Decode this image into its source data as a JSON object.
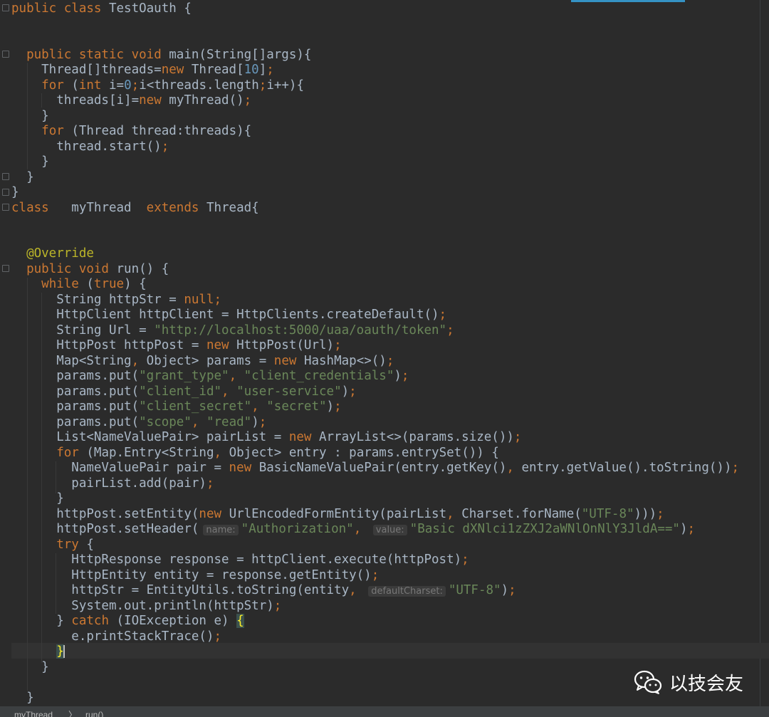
{
  "editor": {
    "lines": [
      [
        [
          "kw",
          "public class "
        ],
        [
          "plain",
          "TestOauth {"
        ]
      ],
      [],
      [],
      [
        [
          "plain",
          "  "
        ],
        [
          "kw",
          "public static void "
        ],
        [
          "plain",
          "main(String[]args){"
        ]
      ],
      [
        [
          "plain",
          "    Thread[]threads="
        ],
        [
          "kw",
          "new "
        ],
        [
          "plain",
          "Thread["
        ],
        [
          "num",
          "10"
        ],
        [
          "plain",
          "]"
        ],
        [
          "kw",
          ";"
        ]
      ],
      [
        [
          "plain",
          "    "
        ],
        [
          "kw",
          "for "
        ],
        [
          "plain",
          "("
        ],
        [
          "kw",
          "int "
        ],
        [
          "plain",
          "i="
        ],
        [
          "num",
          "0"
        ],
        [
          "kw",
          ";"
        ],
        [
          "plain",
          "i<threads.length"
        ],
        [
          "kw",
          ";"
        ],
        [
          "plain",
          "i++){"
        ]
      ],
      [
        [
          "plain",
          "      threads[i]="
        ],
        [
          "kw",
          "new "
        ],
        [
          "plain",
          "myThread()"
        ],
        [
          "kw",
          ";"
        ]
      ],
      [
        [
          "plain",
          "    }"
        ]
      ],
      [
        [
          "plain",
          "    "
        ],
        [
          "kw",
          "for "
        ],
        [
          "plain",
          "(Thread thread:threads){"
        ]
      ],
      [
        [
          "plain",
          "      thread.start()"
        ],
        [
          "kw",
          ";"
        ]
      ],
      [
        [
          "plain",
          "    }"
        ]
      ],
      [
        [
          "plain",
          "  }"
        ]
      ],
      [
        [
          "plain",
          "}"
        ]
      ],
      [
        [
          "kw",
          "class   "
        ],
        [
          "plain",
          "myThread  "
        ],
        [
          "kw",
          "extends "
        ],
        [
          "plain",
          "Thread{"
        ]
      ],
      [],
      [],
      [
        [
          "ann",
          "  @Override"
        ]
      ],
      [
        [
          "plain",
          "  "
        ],
        [
          "kw",
          "public void "
        ],
        [
          "plain",
          "run() {"
        ]
      ],
      [
        [
          "plain",
          "    "
        ],
        [
          "kw",
          "while "
        ],
        [
          "plain",
          "("
        ],
        [
          "kw",
          "true"
        ],
        [
          "plain",
          ") {"
        ]
      ],
      [
        [
          "plain",
          "      String httpStr = "
        ],
        [
          "kw",
          "null;"
        ]
      ],
      [
        [
          "plain",
          "      HttpClient httpClient = HttpClients.createDefault()"
        ],
        [
          "kw",
          ";"
        ]
      ],
      [
        [
          "plain",
          "      String Url = "
        ],
        [
          "str",
          "\"http://localhost:5000/uaa/oauth/token\""
        ],
        [
          "kw",
          ";"
        ]
      ],
      [
        [
          "plain",
          "      HttpPost httpPost = "
        ],
        [
          "kw",
          "new "
        ],
        [
          "plain",
          "HttpPost(Url)"
        ],
        [
          "kw",
          ";"
        ]
      ],
      [
        [
          "plain",
          "      Map<String"
        ],
        [
          "kw",
          ", "
        ],
        [
          "plain",
          "Object> params = "
        ],
        [
          "kw",
          "new "
        ],
        [
          "plain",
          "HashMap<>()"
        ],
        [
          "kw",
          ";"
        ]
      ],
      [
        [
          "plain",
          "      params.put("
        ],
        [
          "str",
          "\"grant_type\""
        ],
        [
          "kw",
          ", "
        ],
        [
          "str",
          "\"client_credentials\""
        ],
        [
          "plain",
          ")"
        ],
        [
          "kw",
          ";"
        ]
      ],
      [
        [
          "plain",
          "      params.put("
        ],
        [
          "str",
          "\"client_id\""
        ],
        [
          "kw",
          ", "
        ],
        [
          "str",
          "\"user-service\""
        ],
        [
          "plain",
          ")"
        ],
        [
          "kw",
          ";"
        ]
      ],
      [
        [
          "plain",
          "      params.put("
        ],
        [
          "str",
          "\"client_secret\""
        ],
        [
          "kw",
          ", "
        ],
        [
          "str",
          "\"secret\""
        ],
        [
          "plain",
          ")"
        ],
        [
          "kw",
          ";"
        ]
      ],
      [
        [
          "plain",
          "      params.put("
        ],
        [
          "str",
          "\"scope\""
        ],
        [
          "kw",
          ", "
        ],
        [
          "str",
          "\"read\""
        ],
        [
          "plain",
          ")"
        ],
        [
          "kw",
          ";"
        ]
      ],
      [
        [
          "plain",
          "      List<NameValuePair> pairList = "
        ],
        [
          "kw",
          "new "
        ],
        [
          "plain",
          "ArrayList<>(params.size())"
        ],
        [
          "kw",
          ";"
        ]
      ],
      [
        [
          "plain",
          "      "
        ],
        [
          "kw",
          "for "
        ],
        [
          "plain",
          "(Map.Entry<String"
        ],
        [
          "kw",
          ", "
        ],
        [
          "plain",
          "Object> entry : params.entrySet()) {"
        ]
      ],
      [
        [
          "plain",
          "        NameValuePair pair = "
        ],
        [
          "kw",
          "new "
        ],
        [
          "plain",
          "BasicNameValuePair(entry.getKey()"
        ],
        [
          "kw",
          ", "
        ],
        [
          "plain",
          "entry.getValue().toString())"
        ],
        [
          "kw",
          ";"
        ]
      ],
      [
        [
          "plain",
          "        pairList.add(pair)"
        ],
        [
          "kw",
          ";"
        ]
      ],
      [
        [
          "plain",
          "      }"
        ]
      ],
      [
        [
          "plain",
          "      httpPost.setEntity("
        ],
        [
          "kw",
          "new "
        ],
        [
          "plain",
          "UrlEncodedFormEntity(pairList"
        ],
        [
          "kw",
          ", "
        ],
        [
          "plain",
          "Charset.forName("
        ],
        [
          "str",
          "\"UTF-8\""
        ],
        [
          "plain",
          ")))"
        ],
        [
          "kw",
          ";"
        ]
      ],
      [
        [
          "plain",
          "      httpPost.setHeader("
        ],
        [
          "hint",
          "name:"
        ],
        [
          "str",
          "\"Authorization\""
        ],
        [
          "kw",
          ", "
        ],
        [
          "hint",
          "value:"
        ],
        [
          "str",
          "\"Basic dXNlci1zZXJ2aWNlOnNlY3JldA==\""
        ],
        [
          "plain",
          ")"
        ],
        [
          "kw",
          ";"
        ]
      ],
      [
        [
          "plain",
          "      "
        ],
        [
          "kw",
          "try "
        ],
        [
          "plain",
          "{"
        ]
      ],
      [
        [
          "plain",
          "        HttpResponse response = httpClient.execute(httpPost)"
        ],
        [
          "kw",
          ";"
        ]
      ],
      [
        [
          "plain",
          "        HttpEntity entity = response.getEntity()"
        ],
        [
          "kw",
          ";"
        ]
      ],
      [
        [
          "plain",
          "        httpStr = EntityUtils.toString(entity"
        ],
        [
          "kw",
          ", "
        ],
        [
          "hint",
          "defaultCharset:"
        ],
        [
          "str",
          "\"UTF-8\""
        ],
        [
          "plain",
          ")"
        ],
        [
          "kw",
          ";"
        ]
      ],
      [
        [
          "plain",
          "        System."
        ],
        [
          "plain",
          "out"
        ],
        [
          "plain",
          ".println(httpStr)"
        ],
        [
          "kw",
          ";"
        ]
      ],
      [
        [
          "plain",
          "      } "
        ],
        [
          "kw",
          "catch "
        ],
        [
          "plain",
          "(IOException e) "
        ],
        [
          "brace",
          "{"
        ]
      ],
      [
        [
          "plain",
          "        e.printStackTrace()"
        ],
        [
          "kw",
          ";"
        ]
      ],
      [
        [
          "plain",
          "      "
        ],
        [
          "brace",
          "}"
        ],
        [
          "caret",
          ""
        ]
      ],
      [
        [
          "plain",
          "    }"
        ]
      ],
      [],
      [
        [
          "plain",
          "  }"
        ]
      ]
    ]
  },
  "breadcrumb": {
    "class_name": "myThread",
    "separator": "〉",
    "method_name": "run()"
  },
  "watermark": {
    "icon": "wechat-icon",
    "text": "以技会友"
  },
  "colors": {
    "background": "#2b2b2b",
    "keyword": "#cc7832",
    "number": "#6897bb",
    "string": "#6a8759",
    "annotation": "#bbb529",
    "text": "#a9b7c6",
    "accent": "#3592c4"
  }
}
